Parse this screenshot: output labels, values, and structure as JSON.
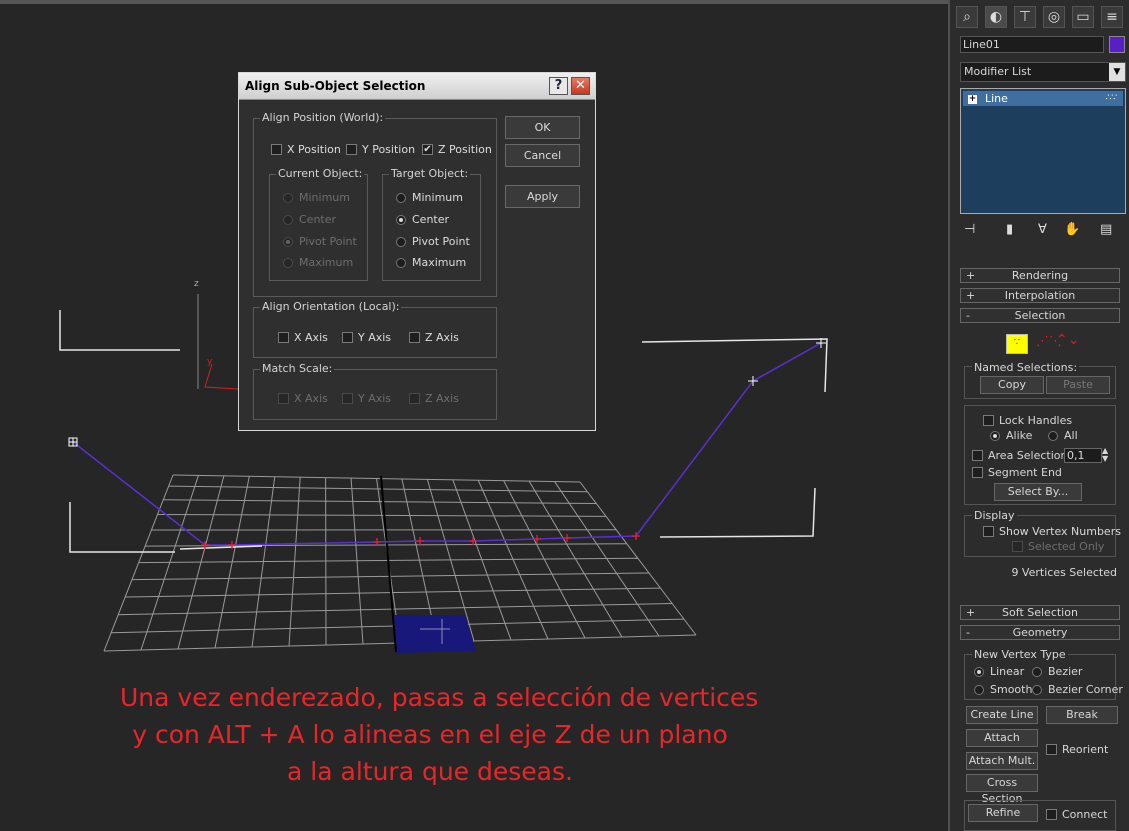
{
  "dialog": {
    "title": "Align Sub-Object Selection",
    "help_label": "?",
    "close_label": "✕",
    "align_position_label": "Align Position (World):",
    "x_position": "X Position",
    "y_position": "Y Position",
    "z_position": "Z Position",
    "x_checked": false,
    "y_checked": false,
    "z_checked": true,
    "current_object_label": "Current Object:",
    "target_object_label": "Target Object:",
    "current_options": [
      "Minimum",
      "Center",
      "Pivot Point",
      "Maximum"
    ],
    "current_selected": "Pivot Point",
    "target_options": [
      "Minimum",
      "Center",
      "Pivot Point",
      "Maximum"
    ],
    "target_selected": "Center",
    "align_orientation_label": "Align Orientation (Local):",
    "orient_x": "X Axis",
    "orient_y": "Y Axis",
    "orient_z": "Z Axis",
    "match_scale_label": "Match Scale:",
    "scale_x": "X Axis",
    "scale_y": "Y Axis",
    "scale_z": "Z Axis",
    "ok_label": "OK",
    "cancel_label": "Cancel",
    "apply_label": "Apply"
  },
  "viewport": {
    "axis_z": "z",
    "axis_y": "y",
    "caption": [
      "Una vez enderezado, pasas a selección de vertices",
      "y con ALT + A lo alineas en el eje Z de un plano",
      "a la altura que deseas."
    ],
    "caption_color": "#e8262a",
    "spline_color": "#5b2fd0",
    "plane_color": "#18187a"
  },
  "panel": {
    "object_name": "Line01",
    "object_color": "#5a1ec8",
    "modifier_list": "Modifier List",
    "stack_item": "Line",
    "rollouts": {
      "rendering": "Rendering",
      "interpolation": "Interpolation",
      "selection": "Selection",
      "soft_selection": "Soft Selection",
      "geometry": "Geometry"
    },
    "sign_plus": "+",
    "sign_minus": "-",
    "named_selections": "Named Selections:",
    "copy": "Copy",
    "paste": "Paste",
    "lock_handles": "Lock Handles",
    "alike": "Alike",
    "all": "All",
    "area_selection": "Area Selection:",
    "area_value": "0,1",
    "segment_end": "Segment End",
    "select_by": "Select By...",
    "display": "Display",
    "show_vertex_numbers": "Show Vertex Numbers",
    "selected_only": "Selected Only",
    "vertices_selected": "9 Vertices Selected",
    "new_vertex_type": "New Vertex Type",
    "linear": "Linear",
    "bezier": "Bezier",
    "smooth": "Smooth",
    "bezier_corner": "Bezier Corner",
    "create_line": "Create Line",
    "break": "Break",
    "attach": "Attach",
    "reorient": "Reorient",
    "attach_mult": "Attach Mult.",
    "cross_section": "Cross Section",
    "refine": "Refine",
    "connect": "Connect"
  }
}
